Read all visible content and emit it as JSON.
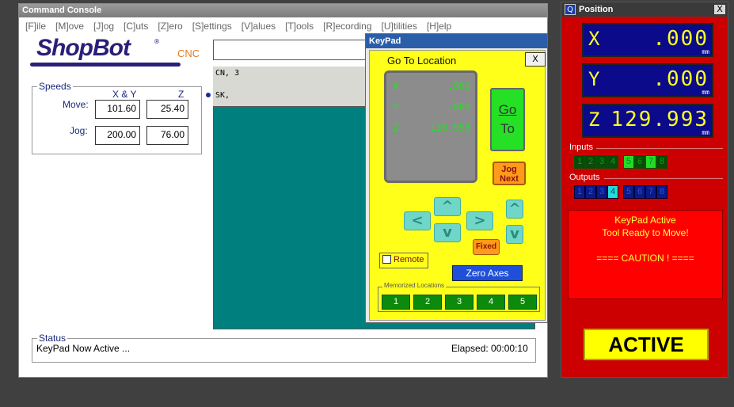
{
  "console": {
    "title": "Command Console",
    "close_glyph": "✕",
    "menu": [
      "[F]ile",
      "[M]ove",
      "[J]og",
      "[C]uts",
      "[Z]ero",
      "[S]ettings",
      "[V]alues",
      "[T]ools",
      "[R]ecording",
      "[U]tilities",
      "[H]elp"
    ],
    "logo": {
      "brand": "ShopBot",
      "reg": "®",
      "suffix": "CNC"
    },
    "speeds": {
      "legend": "Speeds",
      "col_xy": "X & Y",
      "col_z": "Z",
      "move_label": "Move:",
      "jog_label": "Jog:",
      "move_xy": "101.60",
      "move_z": "25.40",
      "jog_xy": "200.00",
      "jog_z": "76.00"
    },
    "command_input": "",
    "history": [
      "CN, 3",
      "SK,"
    ],
    "status": {
      "legend": "Status",
      "text": "KeyPad Now Active ...",
      "elapsed": "Elapsed: 00:00:10"
    }
  },
  "keypad": {
    "title": "KeyPad",
    "goto_label": "Go To Location",
    "close": "X",
    "x_axis": "X",
    "x_value": ".000",
    "y_axis": "Y",
    "y_value": ".000",
    "z_axis": "Z",
    "z_value": "129.993",
    "go_line1": "Go",
    "go_line2": "To",
    "jog_line1": "Jog",
    "jog_line2": "Next",
    "arrows": {
      "up": "^",
      "down": "v",
      "left": "<",
      "right": ">",
      "z_up": "^",
      "z_down": "v"
    },
    "fixed": "Fixed",
    "remote": "Remote",
    "zero_axes": "Zero Axes",
    "memorized_label": "Memorized Locations",
    "memorized": [
      "1",
      "2",
      "3",
      "4",
      "5"
    ]
  },
  "position": {
    "title": "Position",
    "icon_glyph": "Q",
    "close": "X",
    "x_axis": "X",
    "x_value": ".000",
    "y_axis": "Y",
    "y_value": ".000",
    "z_axis": "Z",
    "z_value": "129.993",
    "unit": "mm",
    "inputs_label": "Inputs",
    "inputs": [
      {
        "n": "1",
        "on": false
      },
      {
        "n": "2",
        "on": false
      },
      {
        "n": "3",
        "on": false
      },
      {
        "n": "4",
        "on": false
      },
      {
        "n": "5",
        "on": true
      },
      {
        "n": "6",
        "on": false
      },
      {
        "n": "7",
        "on": true
      },
      {
        "n": "8",
        "on": false
      }
    ],
    "outputs_label": "Outputs",
    "outputs": [
      {
        "n": "1",
        "on": false
      },
      {
        "n": "2",
        "on": false
      },
      {
        "n": "3",
        "on": false
      },
      {
        "n": "4",
        "on": true
      },
      {
        "n": "5",
        "on": false
      },
      {
        "n": "6",
        "on": false
      },
      {
        "n": "7",
        "on": false
      },
      {
        "n": "8",
        "on": false
      }
    ],
    "message_line1": "KeyPad Active",
    "message_line2": "Tool Ready to Move!",
    "message_line3": "==== CAUTION ! ====",
    "active_label": "ACTIVE"
  },
  "colors": {
    "keypad_bg": "#ffff1a",
    "position_bg": "#cc0000",
    "dro_bg": "#0a0a8a",
    "dro_digits": "#ffff22",
    "canvas_teal": "#007f7f"
  }
}
